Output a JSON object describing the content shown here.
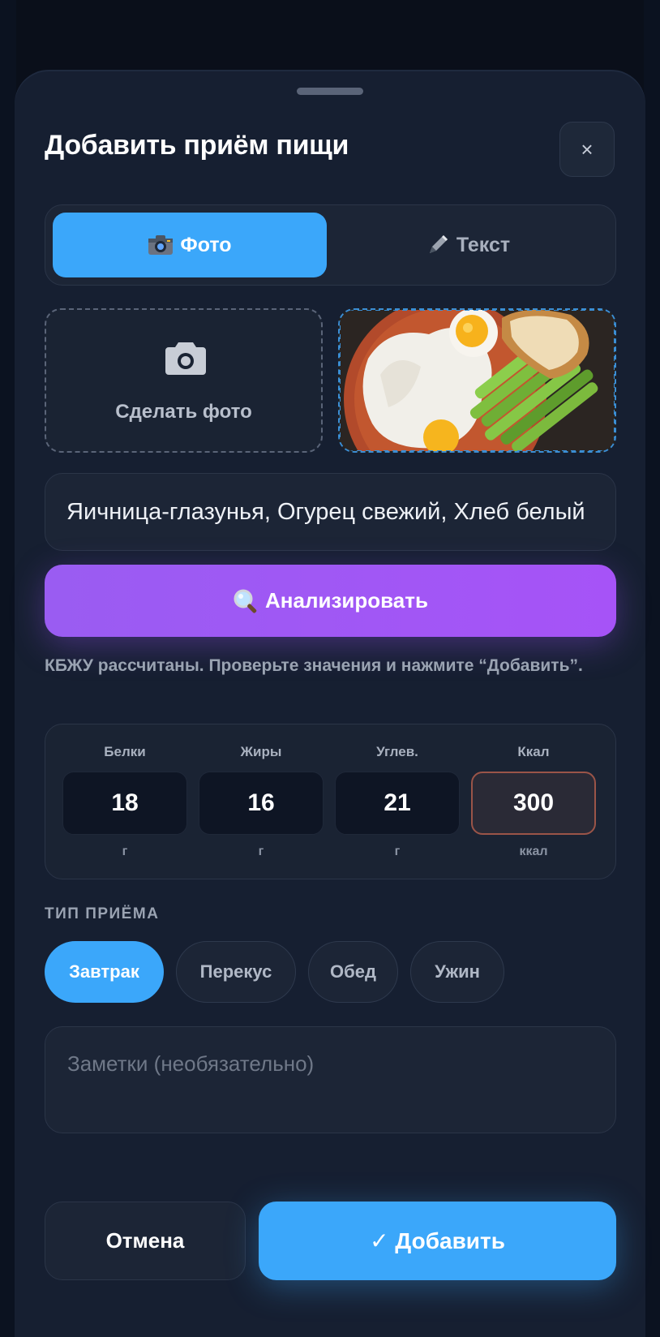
{
  "modal": {
    "title": "Добавить приём пищи",
    "close_icon": "close-icon",
    "close_glyph": "×"
  },
  "input_mode": {
    "tabs": [
      {
        "label": "Фото",
        "icon": "camera-icon",
        "active": true
      },
      {
        "label": "Текст",
        "icon": "pencil-icon",
        "active": false
      }
    ]
  },
  "photo": {
    "take_photo_label": "Сделать фото",
    "take_photo_icon": "camera-icon",
    "preview_image": "photo-preview-fried-eggs-cucumber-bread"
  },
  "food_text": {
    "value": "Яичница-глазунья, Огурец свежий, Хлеб белый"
  },
  "analyze": {
    "label": "Анализировать",
    "icon": "magnifier-icon"
  },
  "hint": "КБЖУ рассчитаны. Проверьте значения и нажмите “Добавить”.",
  "macros": [
    {
      "label": "Белки",
      "value": "18",
      "unit": "г"
    },
    {
      "label": "Жиры",
      "value": "16",
      "unit": "г"
    },
    {
      "label": "Углев.",
      "value": "21",
      "unit": "г"
    },
    {
      "label": "Ккал",
      "value": "300",
      "unit": "ккал"
    }
  ],
  "meal_type": {
    "section_label": "ТИП ПРИЁМА",
    "options": [
      {
        "label": "Завтрак",
        "selected": true
      },
      {
        "label": "Перекус",
        "selected": false
      },
      {
        "label": "Обед",
        "selected": false
      },
      {
        "label": "Ужин",
        "selected": false
      }
    ]
  },
  "notes": {
    "placeholder": "Заметки (необязательно)",
    "value": ""
  },
  "actions": {
    "cancel_label": "Отмена",
    "add_label": "✓ Добавить"
  },
  "colors": {
    "accent_blue": "#3ba7fa",
    "accent_purple": "#a653f7",
    "sheet_bg": "#161f31",
    "kcal_border": "#9a5448"
  }
}
